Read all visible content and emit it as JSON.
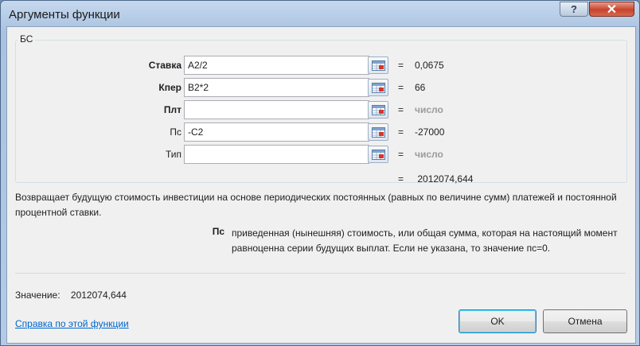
{
  "window": {
    "title": "Аргументы функции"
  },
  "titlebar": {
    "help_glyph": "?",
    "close_glyph": "✕"
  },
  "function_name": "БС",
  "args": [
    {
      "label": "Ставка",
      "bold": true,
      "value": "A2/2",
      "result": "0,0675",
      "result_muted": false
    },
    {
      "label": "Кпер",
      "bold": true,
      "value": "B2*2",
      "result": "66",
      "result_muted": false
    },
    {
      "label": "Плт",
      "bold": true,
      "value": "",
      "result": "число",
      "result_muted": true
    },
    {
      "label": "Пс",
      "bold": false,
      "value": "-C2",
      "result": "-27000",
      "result_muted": false
    },
    {
      "label": "Тип",
      "bold": false,
      "value": "",
      "result": "число",
      "result_muted": true
    }
  ],
  "equals_sign": "=",
  "formula_result": "2012074,644",
  "description": "Возвращает будущую стоимость инвестиции на основе периодических постоянных (равных по величине сумм) платежей и постоянной процентной ставки.",
  "current_param": {
    "name": "Пс",
    "description": "приведенная (нынешняя) стоимость, или общая сумма, которая на настоящий момент равноценна серии будущих выплат. Если не указана, то значение пс=0."
  },
  "value_line": {
    "label": "Значение:",
    "value": "2012074,644"
  },
  "help_link": "Справка по этой функции",
  "buttons": {
    "ok": "OK",
    "cancel": "Отмена"
  }
}
